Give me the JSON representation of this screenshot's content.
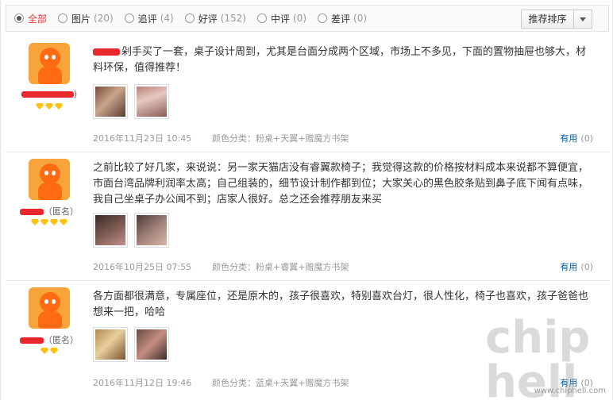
{
  "filters": [
    {
      "label": "全部",
      "count": "",
      "active": true
    },
    {
      "label": "图片",
      "count": "(20)"
    },
    {
      "label": "追评",
      "count": "(4)"
    },
    {
      "label": "好评",
      "count": "(152)"
    },
    {
      "label": "中评",
      "count": "(0)"
    },
    {
      "label": "差评",
      "count": "(0)"
    }
  ],
  "sort": {
    "label": "推荐排序"
  },
  "reviews": [
    {
      "user_suffix": ")",
      "text_rest": "剁手买了一套，桌子设计周到，尤其是台面分成两个区域，市场上不多见，下面的置物抽屉也够大，材料环保，值得推荐！",
      "date": "2016年11月23日  10:45",
      "color": "颜色分类：粉桌+天翼+赠魔方书架",
      "useful_label": "有用",
      "useful_count": "(0)"
    },
    {
      "user_suffix": "（匿名）",
      "text": "之前比较了好几家，来说说：另一家天猫店没有睿翼款椅子；我觉得这款的价格按材料成本来说都不算便宜，市面台湾品牌利润率太高；自己组装的，细节设计制作都到位；大家关心的黑色胶条贴到鼻子底下闻有点味，我自己坐桌子办公闻不到；店家人很好。总之还会推荐朋友来买",
      "date": "2016年10月25日  07:55",
      "color": "颜色分类：粉桌+睿翼+赠魔方书架",
      "useful_label": "有用",
      "useful_count": "(0)"
    },
    {
      "user_suffix": "（匿名）",
      "text": "各方面都很满意，专属座位，还是原木的，孩子很喜欢，特别喜欢台灯，很人性化，椅子也喜欢，孩子爸爸也想来一把，哈哈",
      "date": "2016年11月12日  19:46",
      "color": "颜色分类：蓝桌+天翼+赠魔方书架",
      "useful_label": "有用",
      "useful_count": "(0)"
    }
  ],
  "watermark": {
    "site": "www.chiphell.com",
    "logo_text": "chip hell"
  }
}
